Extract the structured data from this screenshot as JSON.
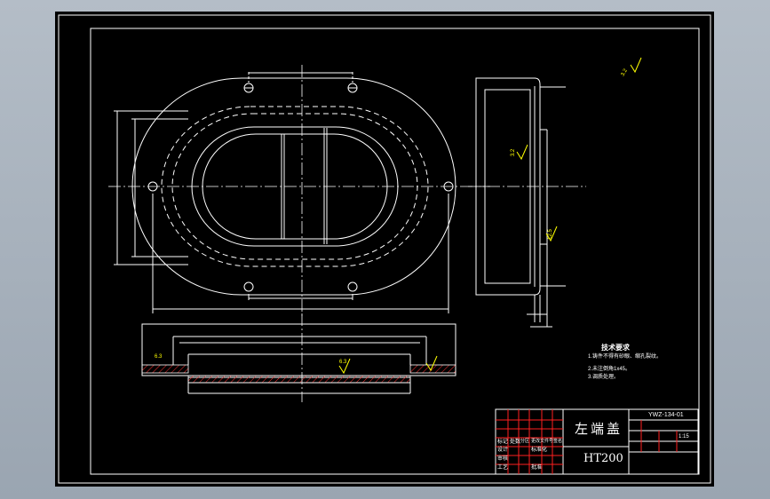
{
  "title_block": {
    "part_name": "左端盖",
    "material": "HT200",
    "drawing_no": "YWZ-134-01",
    "scale": "1:15",
    "row_labels": [
      "标记",
      "设计",
      "审核",
      "工艺"
    ],
    "row_labels_b": [
      "处数",
      "标准化",
      "批准"
    ],
    "header_small": [
      "分区",
      "更改文件号",
      "签名"
    ]
  },
  "technical_requirements": {
    "heading": "技术要求",
    "items": [
      "1.铸件不得有砂眼、缩孔裂纹。",
      "2.未注倒角1x45。",
      "3.调质处理。"
    ]
  },
  "annotations": {
    "surface_finish_1": "3.2",
    "surface_finish_2": "12.5",
    "surface_finish_3": "6.3",
    "surface_finish_4": "3.2",
    "surface_finish_5": "6.3"
  },
  "colors": {
    "line": "#ffffff",
    "title_grid": "#ff2020",
    "annotation": "#ffff00",
    "background": "#000000"
  }
}
